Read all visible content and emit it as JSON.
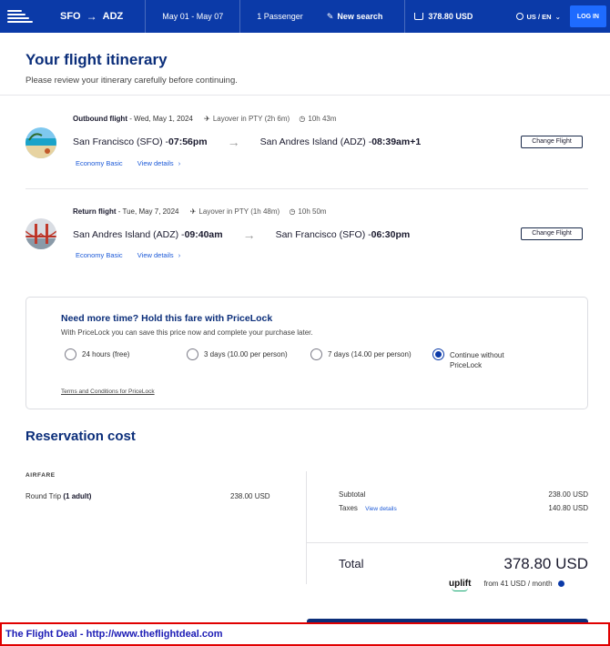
{
  "header": {
    "origin": "SFO",
    "arrow": "→",
    "destination": "ADZ",
    "dates": "May 01 - May 07",
    "passengers": "1 Passenger",
    "new_search": "New search",
    "cart_total": "378.80 USD",
    "locale": "US / EN",
    "login": "LOG IN"
  },
  "page": {
    "title": "Your flight itinerary",
    "subtitle": "Please review your itinerary carefully before continuing."
  },
  "outbound": {
    "label": "Outbound flight",
    "date": " - Wed, May 1, 2024",
    "layover": "Layover in PTY (2h 6m)",
    "duration": "10h 43m",
    "from": "San Francisco (SFO) - ",
    "from_time": "07:56pm",
    "to": "San Andres Island (ADZ) - ",
    "to_time": "08:39am+1",
    "fare": "Economy Basic",
    "details": "View details",
    "change": "Change Flight"
  },
  "return": {
    "label": "Return flight",
    "date": " - Tue, May 7, 2024",
    "layover": "Layover in PTY (1h 48m)",
    "duration": "10h 50m",
    "from": "San Andres Island (ADZ) - ",
    "from_time": "09:40am",
    "to": "San Francisco (SFO) - ",
    "to_time": "06:30pm",
    "fare": "Economy Basic",
    "details": "View details",
    "change": "Change Flight"
  },
  "pricelock": {
    "title": "Need more time? Hold this fare with PriceLock",
    "subtitle": "With PriceLock you can save this price now and complete your purchase later.",
    "options": [
      {
        "label": "24 hours (free)",
        "selected": false
      },
      {
        "label": "3 days (10.00 per person)",
        "selected": false
      },
      {
        "label": "7 days (14.00 per person)",
        "selected": false
      },
      {
        "label": "Continue without PriceLock",
        "selected": true
      }
    ],
    "terms": "Terms and Conditions for PriceLock"
  },
  "reservation": {
    "title": "Reservation cost",
    "airfare_heading": "AIRFARE",
    "trip_label": "Round Trip ",
    "trip_detail": "(1 adult)",
    "trip_price": "238.00 USD",
    "subtotal_label": "Subtotal",
    "subtotal_value": "238.00 USD",
    "taxes_label": "Taxes",
    "taxes_link": "View details",
    "taxes_value": "140.80 USD",
    "total_label": "Total",
    "total_value": "378.80 USD",
    "uplift_brand": "uplift",
    "uplift_text": "from 41 USD  / month"
  },
  "footer": {
    "text": "The Flight Deal - http://www.theflightdeal.com"
  },
  "colors": {
    "brand": "#0b3aa8",
    "accent": "#1e6bff",
    "heading": "#0b2e7a",
    "footer_border": "#e00000"
  }
}
